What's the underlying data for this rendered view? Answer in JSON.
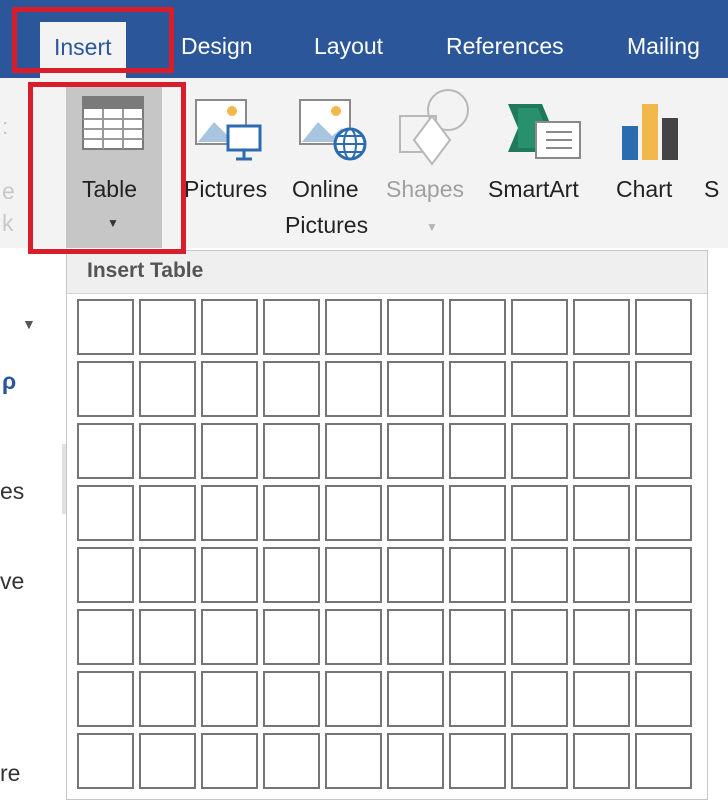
{
  "tabs": [
    {
      "label": "Insert",
      "active": true
    },
    {
      "label": "Design"
    },
    {
      "label": "Layout"
    },
    {
      "label": "References"
    },
    {
      "label": "Mailing"
    }
  ],
  "ribbon": {
    "table": "Table",
    "pictures": "Pictures",
    "online_pictures_line1": "Online",
    "online_pictures_line2": "Pictures",
    "shapes": "Shapes",
    "smartart": "SmartArt",
    "chart": "Chart",
    "cutoff_right": "S"
  },
  "dropdown": {
    "title": "Insert Table",
    "rows": 8,
    "cols": 10
  },
  "left_fragments": {
    "frag_es": "es",
    "frag_ve": "ve",
    "frag_re": "re"
  },
  "colors": {
    "ribbon_blue": "#2b579a",
    "highlight_red": "#d81e2a"
  }
}
